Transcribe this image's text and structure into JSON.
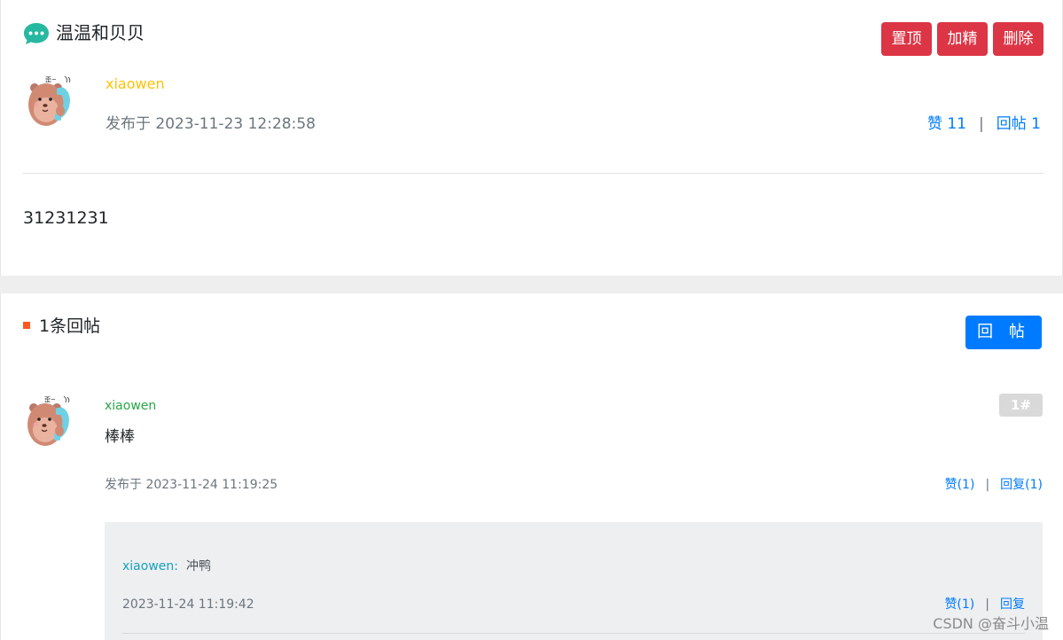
{
  "post": {
    "title": "温温和贝贝",
    "buttons": {
      "pin": "置顶",
      "fine": "加精",
      "delete": "删除"
    },
    "author": "xiaowen",
    "published": "发布于 2023-11-23 12:28:58",
    "like_label": "赞 11",
    "reply_label": "回帖 1",
    "separator": "|",
    "content": "31231231"
  },
  "replies": {
    "count_label": "1条回帖",
    "reply_button": "回 帖",
    "items": [
      {
        "author": "xiaowen",
        "floor": "1#",
        "content": "棒棒",
        "published": "发布于 2023-11-24 11:19:25",
        "like_label": "赞(1)",
        "reply_label": "回复(1)",
        "comments": [
          {
            "author": "xiaowen",
            "colon": ":",
            "content": "冲鸭",
            "time": "2023-11-24 11:19:42",
            "like_label": "赞(1)",
            "reply_label": "回复"
          }
        ]
      }
    ]
  },
  "watermark": "CSDN @奋斗小温",
  "colors": {
    "danger": "#dc3545",
    "primary": "#007bff",
    "warning": "#ffc107",
    "success": "#28a745",
    "info": "#17a2b8",
    "accent": "#ff5722",
    "chat_icon": "#26b8a0"
  },
  "icons": {
    "title_icon": "chat-bubble-icon",
    "avatar": "bear-with-phone-avatar"
  }
}
